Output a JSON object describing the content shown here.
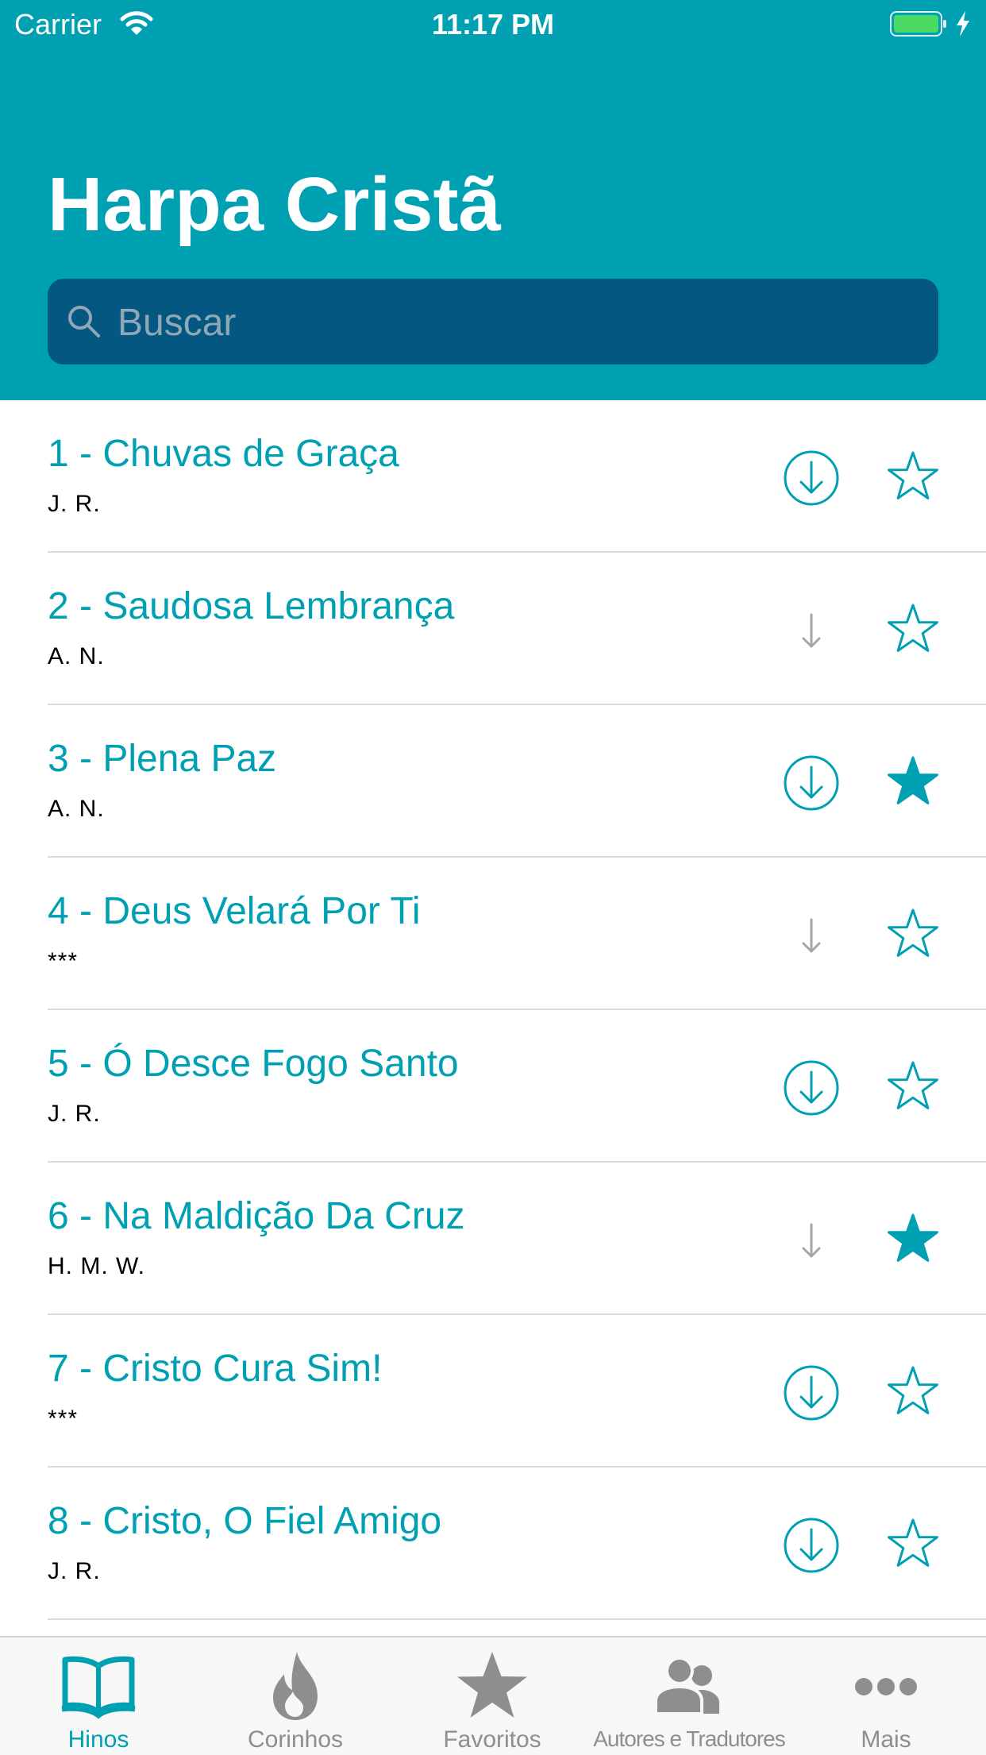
{
  "status_bar": {
    "carrier": "Carrier",
    "time": "11:17 PM"
  },
  "header": {
    "title": "Harpa Cristã"
  },
  "search": {
    "placeholder": "Buscar",
    "value": ""
  },
  "colors": {
    "accent": "#00a0b3",
    "search_bg": "#045780",
    "inactive": "#8e8e8e",
    "download_disabled": "#a6a6a6"
  },
  "hymns": [
    {
      "title": "1 - Chuvas de Graça",
      "author": "J. R.",
      "download_available": true,
      "favorite": false
    },
    {
      "title": "2 - Saudosa Lembrança",
      "author": "A. N.",
      "download_available": false,
      "favorite": false
    },
    {
      "title": "3 - Plena Paz",
      "author": "A. N.",
      "download_available": true,
      "favorite": true
    },
    {
      "title": "4 - Deus Velará Por Ti",
      "author": "***",
      "download_available": false,
      "favorite": false
    },
    {
      "title": "5 - Ó Desce Fogo Santo",
      "author": "J. R.",
      "download_available": true,
      "favorite": false
    },
    {
      "title": "6 - Na Maldição Da Cruz",
      "author": "H. M. W.",
      "download_available": false,
      "favorite": true
    },
    {
      "title": "7 - Cristo Cura Sim!",
      "author": "***",
      "download_available": true,
      "favorite": false
    },
    {
      "title": "8 - Cristo, O Fiel Amigo",
      "author": "J. R.",
      "download_available": true,
      "favorite": false
    }
  ],
  "tabbar": {
    "active": "hinos",
    "tabs": [
      {
        "id": "hinos",
        "label": "Hinos",
        "icon": "book-icon"
      },
      {
        "id": "corinhos",
        "label": "Corinhos",
        "icon": "flame-icon"
      },
      {
        "id": "favoritos",
        "label": "Favoritos",
        "icon": "star-icon"
      },
      {
        "id": "autores",
        "label": "Autores e Tradutores",
        "icon": "people-icon"
      },
      {
        "id": "mais",
        "label": "Mais",
        "icon": "more-icon"
      }
    ]
  }
}
